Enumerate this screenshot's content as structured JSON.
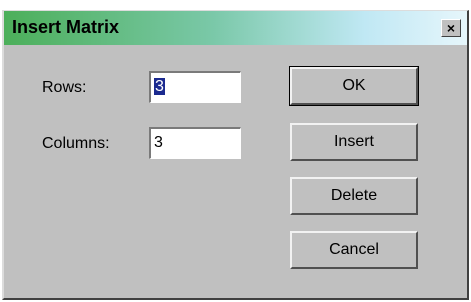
{
  "window": {
    "title": "Insert Matrix",
    "close_glyph": "×"
  },
  "form": {
    "rows_label": "Rows:",
    "rows_value": "3",
    "columns_label": "Columns:",
    "columns_value": "3"
  },
  "buttons": {
    "ok": "OK",
    "insert": "Insert",
    "delete": "Delete",
    "cancel": "Cancel"
  },
  "colors": {
    "dialog_bg": "#c0c0c0",
    "selection": "#1b2a8f",
    "title_gradient_start": "#4caf5a",
    "title_gradient_end": "#e6f6fb"
  }
}
